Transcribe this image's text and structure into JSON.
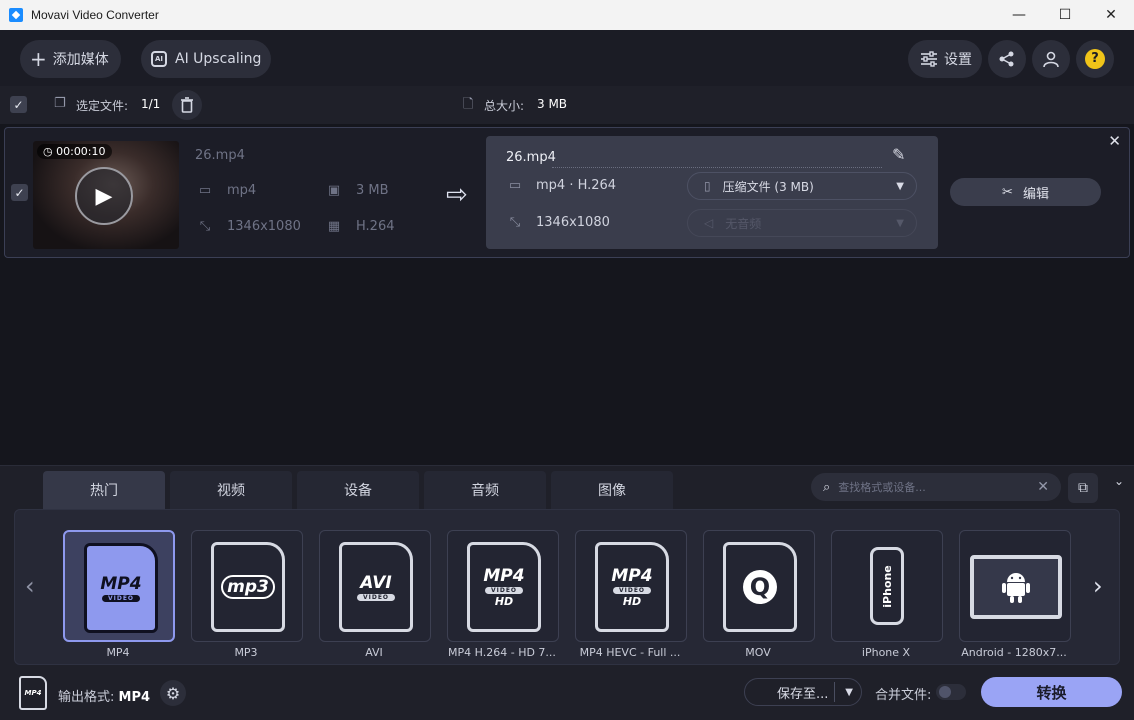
{
  "window": {
    "title": "Movavi Video Converter",
    "min": "—",
    "max": "☐",
    "close": "✕"
  },
  "toolbar": {
    "add_media": "添加媒体",
    "ai_upscaling": "AI Upscaling",
    "settings": "设置"
  },
  "selection": {
    "selected_label": "选定文件:",
    "selected_value": "1/1",
    "total_label": "总大小:",
    "total_value": "3 MB"
  },
  "file": {
    "duration": "00:00:10",
    "name": "26.mp4",
    "format": "mp4",
    "size": "3 MB",
    "resolution": "1346x1080",
    "codec": "H.264"
  },
  "output": {
    "name": "26.mp4",
    "format_codec": "mp4 · H.264",
    "resolution": "1346x1080",
    "compress": "压缩文件 (3 MB)",
    "audio": "无音频",
    "edit": "编辑"
  },
  "tabs": [
    "热门",
    "视频",
    "设备",
    "音频",
    "图像"
  ],
  "search": {
    "placeholder": "查找格式或设备..."
  },
  "formats": [
    {
      "label": "MP4",
      "icon": "MP4",
      "sub": "VIDEO",
      "extra": ""
    },
    {
      "label": "MP3",
      "icon": "mp3",
      "sub": "",
      "extra": ""
    },
    {
      "label": "AVI",
      "icon": "AVI",
      "sub": "VIDEO",
      "extra": ""
    },
    {
      "label": "MP4 H.264 - HD 7...",
      "icon": "MP4",
      "sub": "VIDEO",
      "extra": "HD"
    },
    {
      "label": "MP4 HEVC - Full ...",
      "icon": "MP4",
      "sub": "VIDEO",
      "extra": "HD"
    },
    {
      "label": "MOV",
      "icon": "Q",
      "sub": "",
      "extra": ""
    },
    {
      "label": "iPhone X",
      "icon": "iPhone",
      "sub": "",
      "extra": ""
    },
    {
      "label": "Android - 1280x7...",
      "icon": "android",
      "sub": "",
      "extra": ""
    }
  ],
  "footer": {
    "output_icon": "MP4",
    "output_label": "输出格式:",
    "output_value": "MP4",
    "save_to": "保存至...",
    "merge": "合并文件:",
    "convert": "转换"
  }
}
